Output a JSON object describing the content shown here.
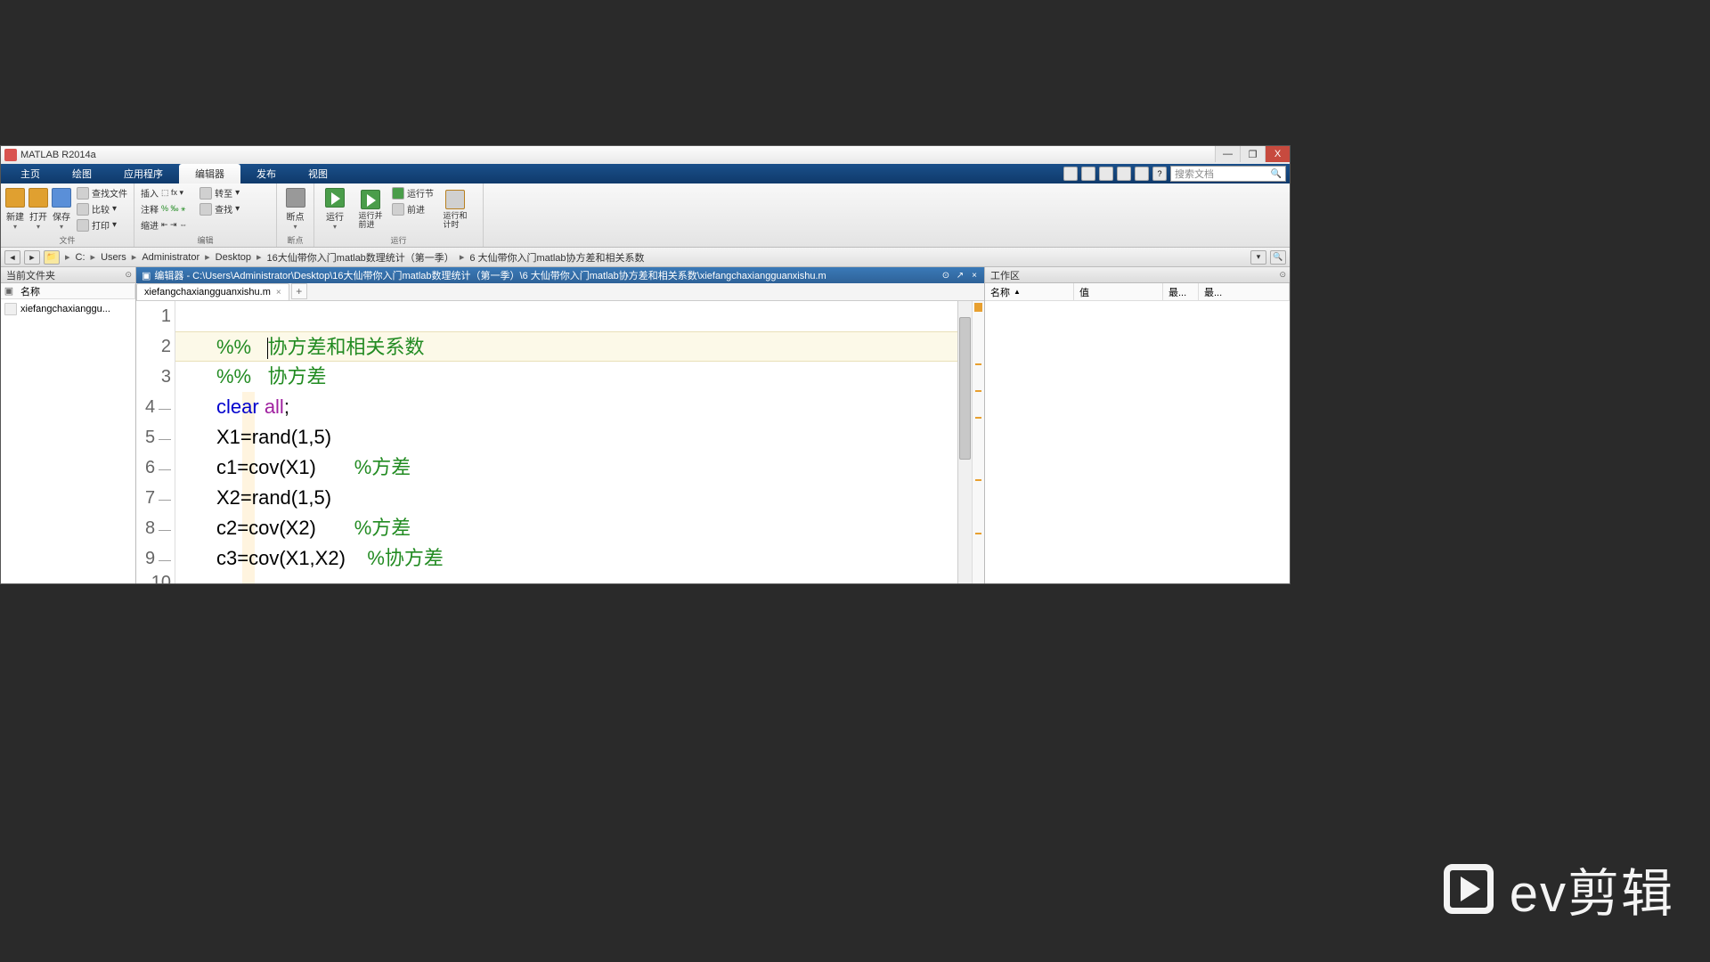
{
  "window": {
    "title": "MATLAB R2014a"
  },
  "win_controls": {
    "min": "—",
    "max": "❐",
    "close": "X"
  },
  "tabs": {
    "items": [
      "主页",
      "绘图",
      "应用程序",
      "编辑器",
      "发布",
      "视图"
    ],
    "active_index": 3
  },
  "search_docs": {
    "placeholder": "搜索文档"
  },
  "ribbon": {
    "file_group": {
      "new": "新建",
      "open": "打开",
      "save": "保存",
      "find_files": "查找文件",
      "compare": "比较",
      "print": "打印",
      "label": "文件"
    },
    "edit_group": {
      "insert": "插入",
      "comment": "注释",
      "indent": "缩进",
      "goto": "转至",
      "find": "查找",
      "label": "编辑"
    },
    "bp_group": {
      "breakpoint": "断点",
      "label": "断点"
    },
    "run_group": {
      "run": "运行",
      "run_advance": "运行并\n前进",
      "run_section": "运行节",
      "advance": "前进",
      "run_time": "运行和\n计时",
      "label": "运行"
    }
  },
  "breadcrumbs": {
    "drive": "C:",
    "items": [
      "Users",
      "Administrator",
      "Desktop",
      "16大仙带你入门matlab数理统计（第一季）",
      "6  大仙带你入门matlab协方差和相关系数"
    ]
  },
  "current_folder": {
    "title": "当前文件夹",
    "name_col": "名称",
    "file": "xiefangchaxianggu..."
  },
  "editor": {
    "title": "编辑器 - C:\\Users\\Administrator\\Desktop\\16大仙带你入门matlab数理统计（第一季）\\6  大仙带你入门matlab协方差和相关系数\\xiefangchaxiangguanxishu.m",
    "tab_name": "xiefangchaxiangguanxishu.m",
    "lines": {
      "l2": {
        "pct": "%%",
        "txt": "协方差和相关系数"
      },
      "l3": {
        "pct": "%%",
        "txt": "协方差"
      },
      "l4": {
        "kw": "clear",
        "all": "all",
        "semi": ";"
      },
      "l5": "X1=rand(1,5)",
      "l6": {
        "code": "c1=cov(X1)",
        "comment": "%方差"
      },
      "l7": "X2=rand(1,5)",
      "l8": {
        "code": "c2=cov(X2)",
        "comment": "%方差"
      },
      "l9": {
        "code": "c3=cov(X1,X2)",
        "comment": "%协方差"
      },
      "l10_num": "10"
    }
  },
  "workspace": {
    "title": "工作区",
    "cols": {
      "name": "名称",
      "value": "值",
      "min": "最...",
      "max": "最..."
    }
  },
  "watermark": {
    "text": "ev剪辑"
  }
}
